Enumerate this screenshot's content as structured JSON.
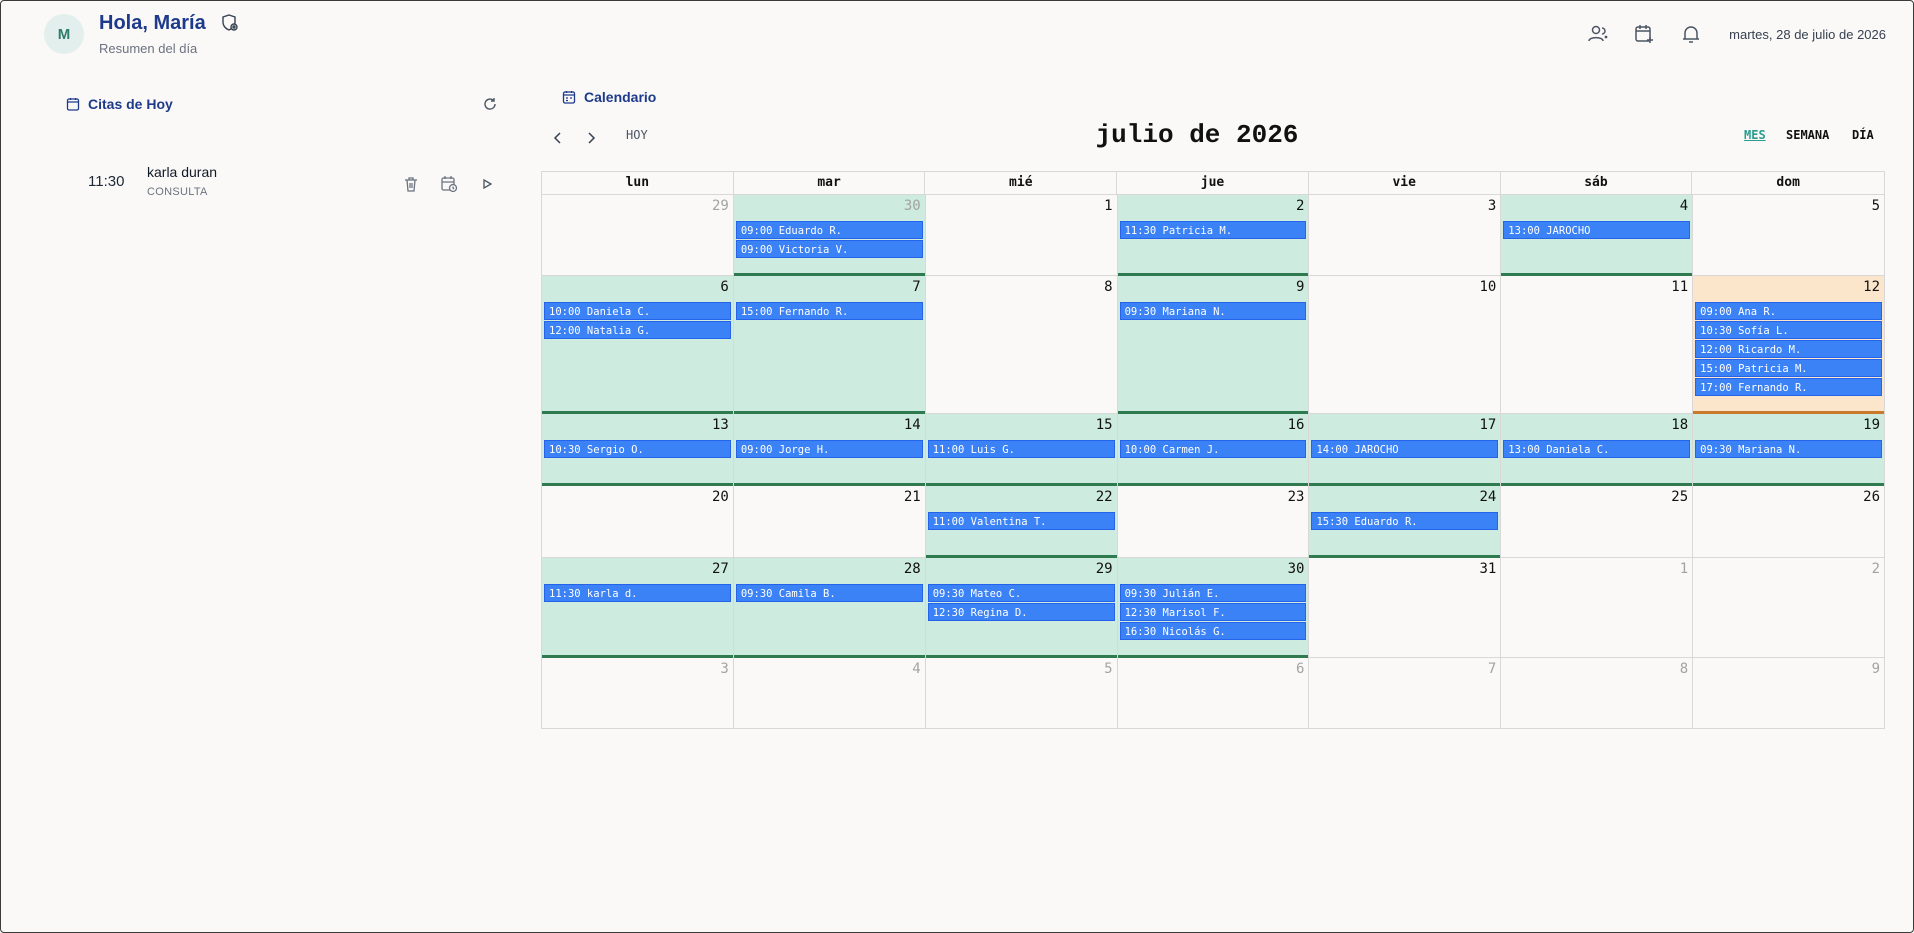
{
  "header": {
    "avatar_initial": "M",
    "greeting": "Hola, María",
    "subtitle": "Resumen del día",
    "date": "martes, 28 de julio de 2026",
    "icons": [
      "users-icon",
      "calendar-add-icon",
      "bell-icon"
    ]
  },
  "today_panel": {
    "title": "Citas de Hoy",
    "appointments": [
      {
        "time": "11:30",
        "name": "karla duran",
        "type": "CONSULTA"
      }
    ]
  },
  "calendar": {
    "title": "Calendario",
    "month_label": "julio de 2026",
    "today_label": "HOY",
    "views": [
      "MES",
      "SEMANA",
      "DÍA"
    ],
    "active_view": "MES",
    "weekdays": [
      "lun",
      "mar",
      "mié",
      "jue",
      "vie",
      "sáb",
      "dom"
    ],
    "colors": {
      "event": "#3b82f6",
      "busy_day": "#cdebdf",
      "today": "#fbe6cc"
    },
    "weeks": [
      [
        {
          "day": "29",
          "other": true,
          "events": []
        },
        {
          "day": "30",
          "other": true,
          "events": [
            "09:00 Eduardo R.",
            "09:00 Victoria V."
          ]
        },
        {
          "day": "1",
          "events": []
        },
        {
          "day": "2",
          "events": [
            "11:30 Patricia M."
          ]
        },
        {
          "day": "3",
          "events": []
        },
        {
          "day": "4",
          "events": [
            "13:00 JAROCHO"
          ]
        },
        {
          "day": "5",
          "events": []
        }
      ],
      [
        {
          "day": "6",
          "events": [
            "10:00 Daniela C.",
            "12:00 Natalia G."
          ]
        },
        {
          "day": "7",
          "events": [
            "15:00 Fernando R."
          ]
        },
        {
          "day": "8",
          "events": []
        },
        {
          "day": "9",
          "events": [
            "09:30 Mariana N."
          ]
        },
        {
          "day": "10",
          "events": []
        },
        {
          "day": "11",
          "events": []
        },
        {
          "day": "12",
          "today": true,
          "events": [
            "09:00 Ana R.",
            "10:30 Sofía L.",
            "12:00 Ricardo M.",
            "15:00 Patricia M.",
            "17:00 Fernando R."
          ]
        }
      ],
      [
        {
          "day": "13",
          "events": [
            "10:30 Sergio O."
          ]
        },
        {
          "day": "14",
          "events": [
            "09:00 Jorge H."
          ]
        },
        {
          "day": "15",
          "events": [
            "11:00 Luis G."
          ]
        },
        {
          "day": "16",
          "events": [
            "10:00 Carmen J."
          ]
        },
        {
          "day": "17",
          "events": [
            "14:00 JAROCHO"
          ]
        },
        {
          "day": "18",
          "events": [
            "13:00 Daniela C."
          ]
        },
        {
          "day": "19",
          "events": [
            "09:30 Mariana N."
          ]
        }
      ],
      [
        {
          "day": "20",
          "events": []
        },
        {
          "day": "21",
          "events": []
        },
        {
          "day": "22",
          "events": [
            "11:00 Valentina T."
          ]
        },
        {
          "day": "23",
          "events": []
        },
        {
          "day": "24",
          "events": [
            "15:30 Eduardo R."
          ]
        },
        {
          "day": "25",
          "events": []
        },
        {
          "day": "26",
          "events": []
        }
      ],
      [
        {
          "day": "27",
          "events": [
            "11:30 karla d."
          ]
        },
        {
          "day": "28",
          "events": [
            "09:30 Camila B."
          ]
        },
        {
          "day": "29",
          "events": [
            "09:30 Mateo C.",
            "12:30 Regina D."
          ]
        },
        {
          "day": "30",
          "events": [
            "09:30 Julián E.",
            "12:30 Marisol F.",
            "16:30 Nicolás G."
          ]
        },
        {
          "day": "31",
          "events": []
        },
        {
          "day": "1",
          "other": true,
          "events": []
        },
        {
          "day": "2",
          "other": true,
          "events": []
        }
      ],
      [
        {
          "day": "3",
          "other": true,
          "events": []
        },
        {
          "day": "4",
          "other": true,
          "events": []
        },
        {
          "day": "5",
          "other": true,
          "events": []
        },
        {
          "day": "6",
          "other": true,
          "events": []
        },
        {
          "day": "7",
          "other": true,
          "events": []
        },
        {
          "day": "8",
          "other": true,
          "events": []
        },
        {
          "day": "9",
          "other": true,
          "events": []
        }
      ]
    ]
  }
}
